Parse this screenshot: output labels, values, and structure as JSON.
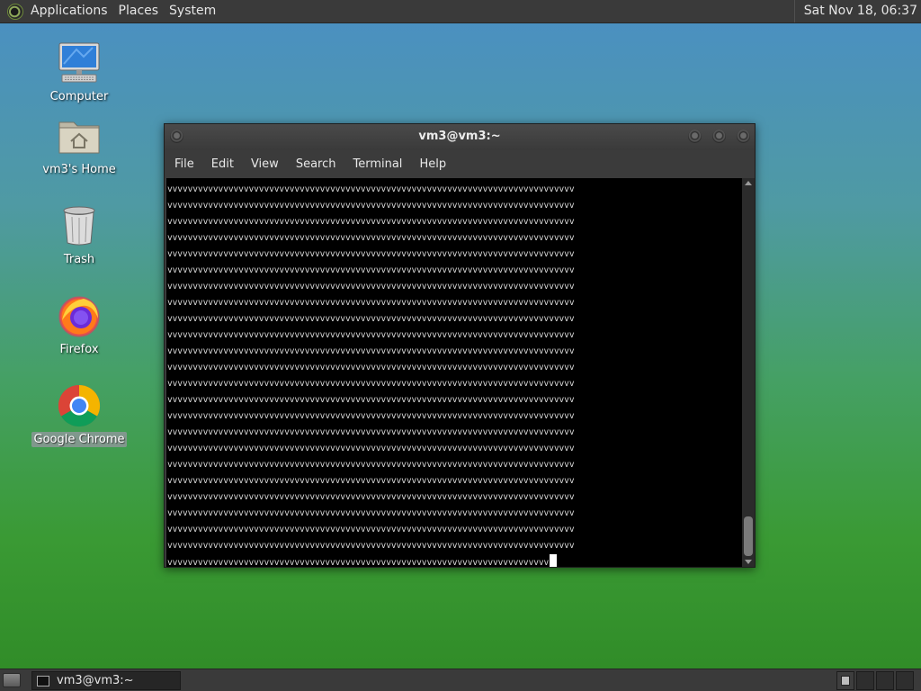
{
  "top_panel": {
    "menus": [
      "Applications",
      "Places",
      "System"
    ],
    "clock": "Sat Nov 18, 06:37"
  },
  "desktop_icons": [
    {
      "label": "Computer",
      "icon": "computer-icon"
    },
    {
      "label": "vm3's Home",
      "icon": "home-folder-icon"
    },
    {
      "label": "Trash",
      "icon": "trash-icon"
    },
    {
      "label": "Firefox",
      "icon": "firefox-icon"
    },
    {
      "label": "Google Chrome",
      "icon": "chrome-icon",
      "selected": true
    }
  ],
  "terminal": {
    "title": "vm3@vm3:~",
    "menu": [
      "File",
      "Edit",
      "View",
      "Search",
      "Terminal",
      "Help"
    ],
    "line_char": "v",
    "full_line_count": 23,
    "chars_per_line": 80,
    "last_line_chars": 75,
    "scroll_position": 0.95
  },
  "bottom_panel": {
    "task_label": "vm3@vm3:~",
    "workspaces": 4,
    "active_workspace": 1
  },
  "colors": {
    "panel_bg": "#3a3a3a",
    "terminal_bg": "#000000",
    "terminal_fg": "#d9d9d9",
    "desktop_top": "#4a8fc4",
    "desktop_bottom": "#2f8a26"
  }
}
